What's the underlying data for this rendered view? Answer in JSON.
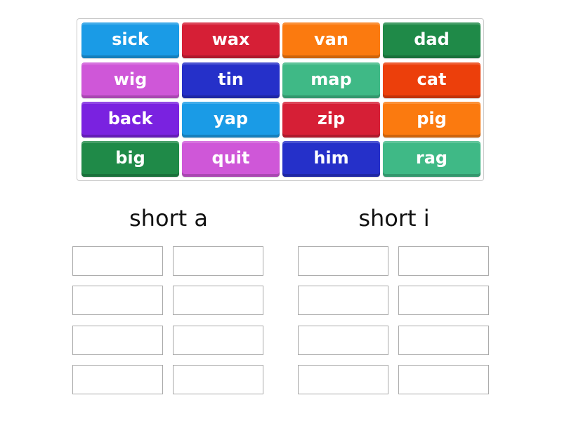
{
  "activity": {
    "type": "group sort",
    "tiles": [
      {
        "label": "sick",
        "color": "#1a9be6"
      },
      {
        "label": "wax",
        "color": "#d61f36"
      },
      {
        "label": "van",
        "color": "#fb7a0f"
      },
      {
        "label": "dad",
        "color": "#1f8a48"
      },
      {
        "label": "wig",
        "color": "#cf57d8"
      },
      {
        "label": "tin",
        "color": "#2530c9"
      },
      {
        "label": "map",
        "color": "#3fb986"
      },
      {
        "label": "cat",
        "color": "#ec3f0b"
      },
      {
        "label": "back",
        "color": "#7a22e0"
      },
      {
        "label": "yap",
        "color": "#1a9be6"
      },
      {
        "label": "zip",
        "color": "#d61f36"
      },
      {
        "label": "pig",
        "color": "#fb7a0f"
      },
      {
        "label": "big",
        "color": "#1f8a48"
      },
      {
        "label": "quit",
        "color": "#cf57d8"
      },
      {
        "label": "him",
        "color": "#2530c9"
      },
      {
        "label": "rag",
        "color": "#3fb986"
      }
    ],
    "groups": [
      {
        "title": "short a",
        "slots": 8
      },
      {
        "title": "short i",
        "slots": 8
      }
    ]
  }
}
